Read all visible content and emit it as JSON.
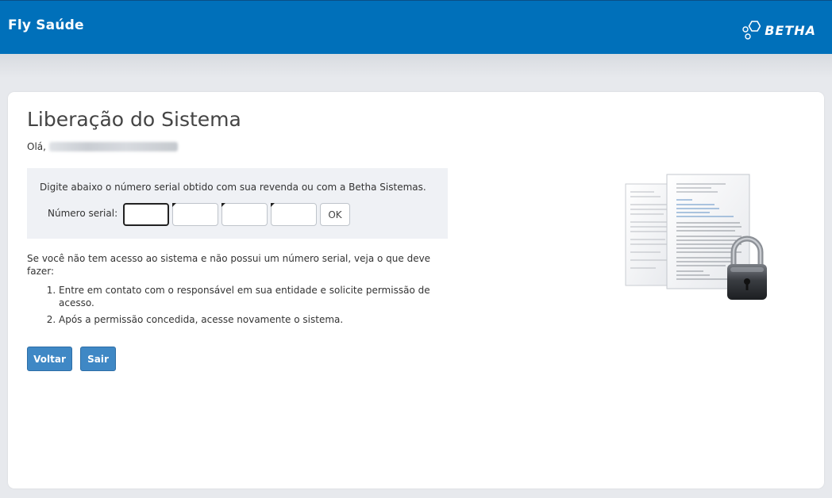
{
  "header": {
    "app_title": "Fly Saúde",
    "brand_name": "BETHA",
    "brand_icon": "betha-hexagon-logo",
    "color": "#0070ba"
  },
  "page": {
    "title": "Liberação do Sistema",
    "greeting": "Olá,",
    "user_name_blurred": true
  },
  "serial_panel": {
    "instruction": "Digite abaixo o número serial obtido com sua revenda ou com a Betha Sistemas.",
    "label": "Número serial:",
    "fields": [
      "",
      "",
      "",
      ""
    ],
    "ok_label": "OK"
  },
  "help": {
    "intro": "Se você não tem acesso ao sistema e não possui um número serial, veja o que deve fazer:",
    "steps": [
      "Entre em contato com o responsável em sua entidade e solicite permissão de acesso.",
      "Após a permissão concedida, acesse novamente o sistema."
    ]
  },
  "actions": {
    "back_label": "Voltar",
    "exit_label": "Sair",
    "button_color": "#3f88c5"
  },
  "illustration": {
    "icon": "locked-documents-icon"
  }
}
